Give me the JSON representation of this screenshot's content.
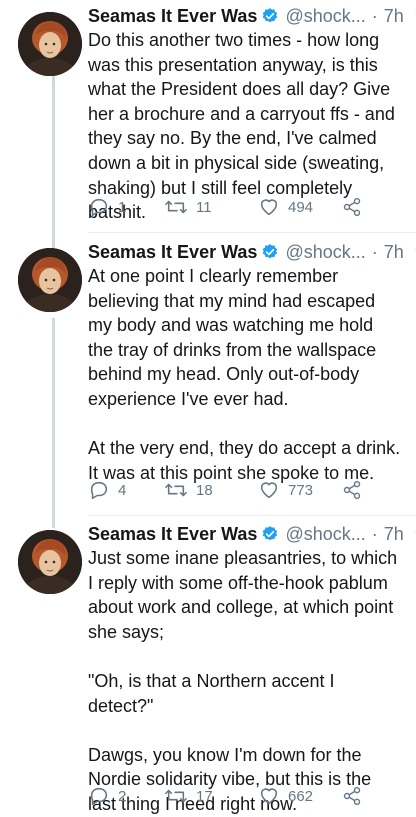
{
  "colors": {
    "verified": "#1da1f2",
    "muted": "#657786",
    "text": "#14171a",
    "thread_line": "#cfd9de"
  },
  "tweets": [
    {
      "author": "Seamas It Ever Was",
      "handle": "@shock...",
      "dot": "·",
      "time": "7h",
      "text": "Do this another two times - how long was this presentation anyway, is this what the President does all day? Give her a brochure and a carryout ffs - and they say no. By the end, I've calmed down a bit in physical side (sweating, shaking) but I still feel completely batshit.",
      "replies": "1",
      "retweets": "11",
      "likes": "494"
    },
    {
      "author": "Seamas It Ever Was",
      "handle": "@shock...",
      "dot": "·",
      "time": "7h",
      "text": "At one point I clearly remember believing that my mind had escaped my body and was watching me hold the tray of drinks from the wallspace behind my head. Only out-of-body experience I've ever had.\n\nAt the very end, they do accept a drink. It was at this point she spoke to me.",
      "replies": "4",
      "retweets": "18",
      "likes": "773"
    },
    {
      "author": "Seamas It Ever Was",
      "handle": "@shock...",
      "dot": "·",
      "time": "7h",
      "text": "Just some inane pleasantries, to which I reply with some off-the-hook pablum about work and college, at which point she says;\n\n\"Oh, is that a Northern accent I detect?\"\n\nDawgs, you know I'm down for the Nordie solidarity vibe, but this is the last thing I need right now.",
      "replies": "2",
      "retweets": "17",
      "likes": "662"
    }
  ]
}
